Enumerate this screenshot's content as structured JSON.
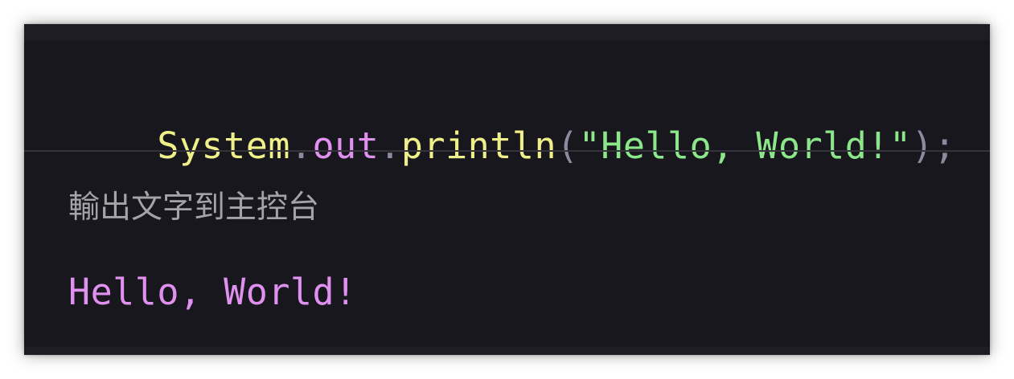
{
  "code": {
    "tokens": [
      {
        "text": "System",
        "color": "#f0f08a"
      },
      {
        "text": ".",
        "color": "#8b8ba0"
      },
      {
        "text": "out",
        "color": "#e091f0"
      },
      {
        "text": ".",
        "color": "#8b8ba0"
      },
      {
        "text": "println",
        "color": "#f0f08a"
      },
      {
        "text": "(",
        "color": "#8b8ba0"
      },
      {
        "text": "\"Hello, World!\"",
        "color": "#8ce68a"
      },
      {
        "text": ")",
        "color": "#8b8ba0"
      },
      {
        "text": ";",
        "color": "#8b8ba0"
      }
    ]
  },
  "caption": {
    "text": "輸出文字到主控台",
    "color": "#a3a3a8"
  },
  "output": {
    "text": "Hello, World!",
    "color": "#e091f0"
  },
  "colors": {
    "background": "#18171d",
    "divider": "#34333c"
  }
}
